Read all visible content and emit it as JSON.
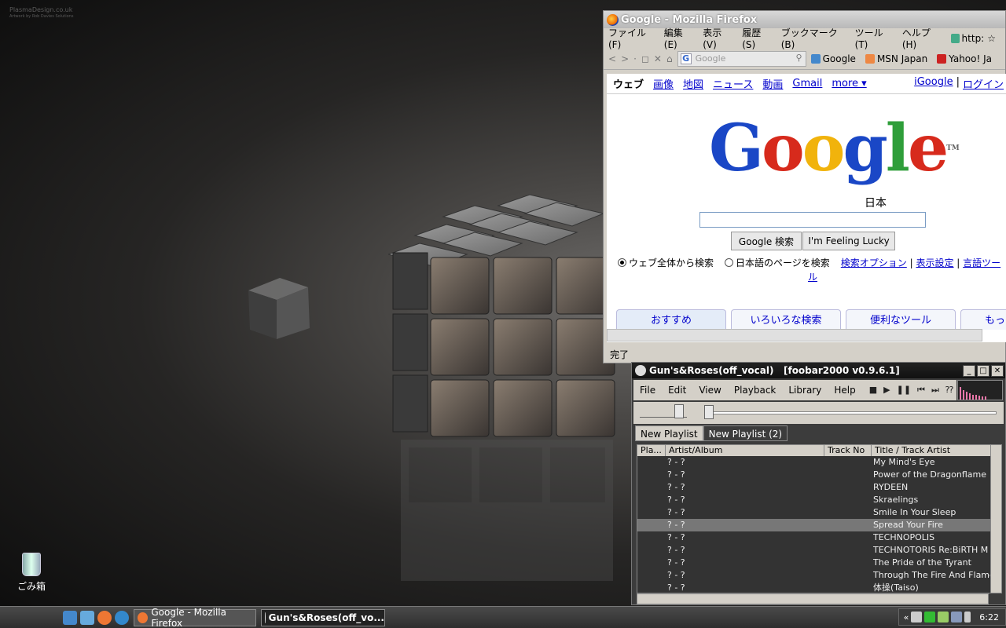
{
  "watermark": {
    "line1": "PlasmaDesign.co.uk",
    "line2": "Artwork by Rob Davies Solutions"
  },
  "desktop": {
    "recycle_bin_label": "ごみ箱"
  },
  "firefox": {
    "title": "Google - Mozilla Firefox",
    "menu": [
      "ファイル(F)",
      "編集(E)",
      "表示(V)",
      "履歴(S)",
      "ブックマーク(B)",
      "ツール(T)",
      "ヘルプ(H)"
    ],
    "url_short": "http:",
    "search_placeholder": "Google",
    "bookmarks": [
      "Google",
      "MSN Japan",
      "Yahoo! Ja"
    ],
    "status": "完了"
  },
  "google": {
    "nav_current": "ウェブ",
    "nav": [
      "画像",
      "地図",
      "ニュース",
      "動画",
      "Gmail",
      "more ▾"
    ],
    "nav_right": [
      "iGoogle",
      "|",
      "ログイン"
    ],
    "logo": "Google",
    "logo_region": "日本",
    "logo_tm": "TM",
    "btn_search": "Google 検索",
    "btn_lucky": "I'm Feeling Lucky",
    "radio_web": "ウェブ全体から検索",
    "radio_jp": "日本語のページを検索",
    "link_options": "検索オプション",
    "link_settings": "表示設定",
    "link_lang": "言語ツー",
    "link_lang_cont": "ル",
    "tabs": [
      "おすすめ",
      "いろいろな検索",
      "便利なツール",
      "もっと楽しく"
    ]
  },
  "foobar": {
    "title": "Gun's&Roses(off_vocal)   [foobar2000 v0.9.6.1]",
    "menu": [
      "File",
      "Edit",
      "View",
      "Playback",
      "Library",
      "Help"
    ],
    "playlist_tabs": [
      "New Playlist",
      "New Playlist (2)"
    ],
    "columns": [
      "Pla...",
      "Artist/Album",
      "Track No",
      "Title / Track Artist"
    ],
    "rows": [
      {
        "artist": "? - ?",
        "title": "My Mind's Eye"
      },
      {
        "artist": "? - ?",
        "title": "Power of the Dragonflame"
      },
      {
        "artist": "? - ?",
        "title": "RYDEEN"
      },
      {
        "artist": "? - ?",
        "title": "Skraelings"
      },
      {
        "artist": "? - ?",
        "title": "Smile In Your Sleep"
      },
      {
        "artist": "? - ?",
        "title": "Spread Your Fire"
      },
      {
        "artist": "? - ?",
        "title": "TECHNOPOLIS"
      },
      {
        "artist": "? - ?",
        "title": "TECHNOTORIS Re:BiRTH M"
      },
      {
        "artist": "? - ?",
        "title": "The Pride of the Tyrant"
      },
      {
        "artist": "? - ?",
        "title": "Through The Fire And Flame"
      },
      {
        "artist": "? - ?",
        "title": "体操(Taiso)"
      }
    ],
    "selected_index": 5
  },
  "taskbar": {
    "tasks": [
      "Google - Mozilla Firefox",
      "Gun's&Roses(off_vo..."
    ],
    "clock": "6:22",
    "tray_chevron": "«"
  }
}
